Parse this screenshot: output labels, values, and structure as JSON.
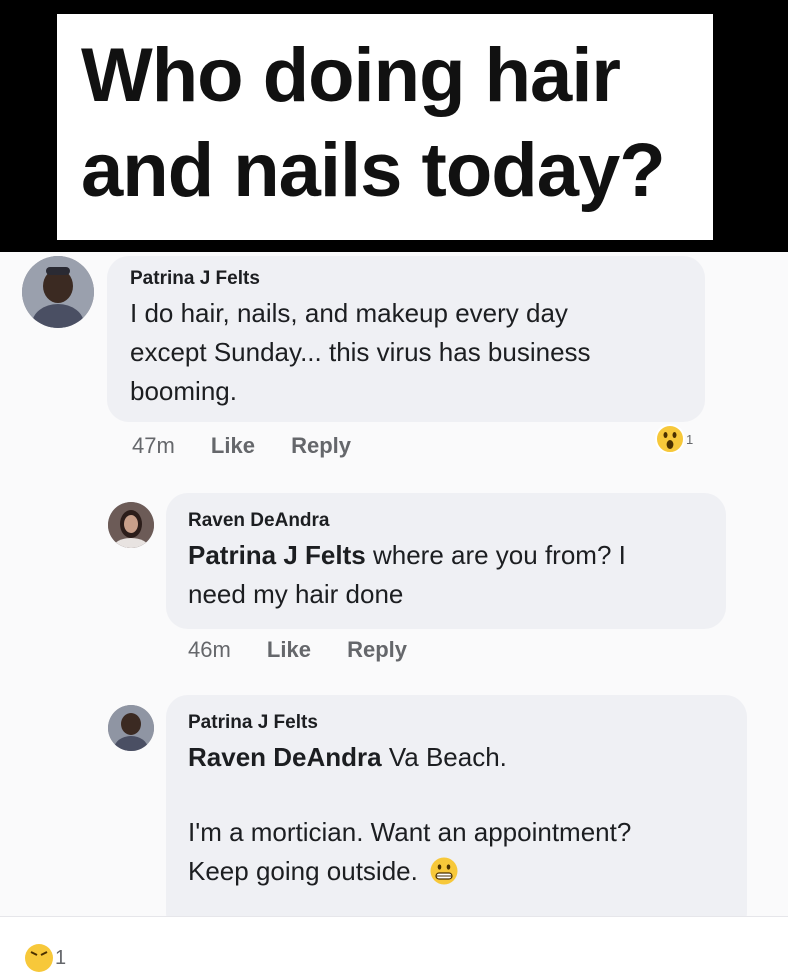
{
  "header": {
    "title_line1": "Who doing hair",
    "title_line2": "and nails today?"
  },
  "comments": [
    {
      "author": "Patrina J Felts",
      "text_lines": [
        "I do hair, nails, and makeup every day",
        "except Sunday... this virus has business",
        "booming."
      ],
      "time": "47m",
      "like": "Like",
      "reply": "Reply",
      "reaction_icon": "wow-emoji-icon",
      "reaction_count": "1"
    },
    {
      "author": "Raven DeAndra",
      "mention": "Patrina J Felts",
      "text_after_mention": " where are you from? I",
      "text_line2": "need my hair done",
      "time": "46m",
      "like": "Like",
      "reply": "Reply"
    },
    {
      "author": "Patrina J Felts",
      "mention": "Raven DeAndra",
      "text_after_mention": " Va Beach.",
      "text_line2": "I'm a mortician. Want an appointment?",
      "text_line3": "Keep going outside.",
      "emoji_icon": "grimace-emoji-icon"
    }
  ],
  "footer": {
    "reaction_count": "1"
  },
  "colors": {
    "bubble": "#eff0f4",
    "meta_text": "#65676b",
    "header_band": "#000000"
  }
}
